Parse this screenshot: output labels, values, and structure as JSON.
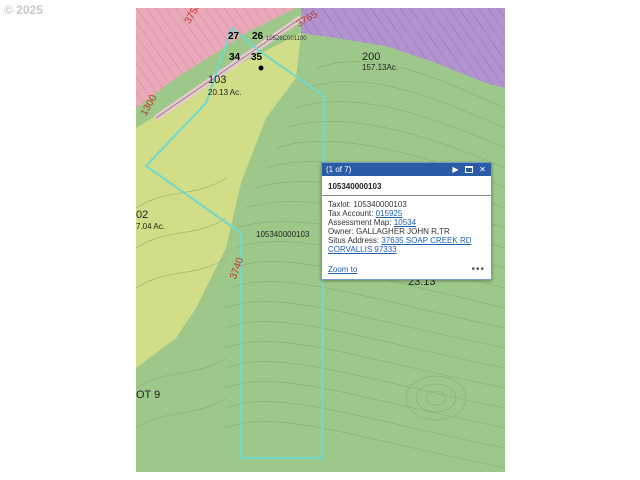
{
  "copyright": "© 2025",
  "colors": {
    "forest": "#9ec88a",
    "farm": "#d6df86",
    "residential": "#e9a9b8",
    "rural": "#b093cf",
    "boundary": "#6fd9cf",
    "popup_header": "#2a5ba6",
    "link": "#1f5fb5"
  },
  "map_labels": {
    "lot_27": "27",
    "lot_26": "26",
    "lot_34": "34",
    "lot_35": "35",
    "map_ref": "10526C001100",
    "parcel_103": "103",
    "acres_103": "20.13 Ac.",
    "parcel_200": "200",
    "acres_200": "157.13Ac.",
    "parcel_102": "02",
    "acres_102": "7.04 Ac.",
    "taxlot_center": "105340000103",
    "value_right": "23.13",
    "lot_9": "OT 9",
    "red_740": "3740",
    "red_1300": "1300",
    "red_3750": "3750",
    "red_3765": "3765"
  },
  "popup": {
    "counter": "(1 of 7)",
    "next_icon": "▶",
    "close_icon": "✕",
    "title": "105340000103",
    "taxlot_label": "Taxlot:",
    "taxlot_value": "105340000103",
    "tax_account_label": "Tax Account:",
    "tax_account_value": "015925",
    "assessment_label": "Assessment Map:",
    "assessment_value": "10534",
    "owner_label": "Owner:",
    "owner_value": "GALLAGHER JOHN R,TR",
    "situs_label": "Situs Address:",
    "situs_line1": "37635 SOAP CREEK RD",
    "situs_line2": "CORVALLIS 97333",
    "zoom_to": "Zoom to",
    "more": "•••"
  }
}
